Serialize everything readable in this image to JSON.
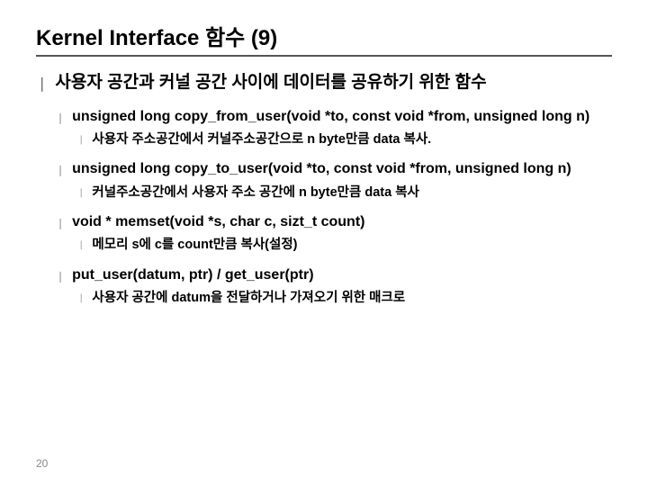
{
  "title": "Kernel Interface 함수 (9)",
  "main": {
    "text": "사용자 공간과 커널 공간 사이에 데이터를 공유하기 위한 함수"
  },
  "items": [
    {
      "heading": "unsigned long copy_from_user(void *to, const void *from, unsigned long n)",
      "desc": "사용자 주소공간에서 커널주소공간으로 n byte만큼 data 복사."
    },
    {
      "heading": "unsigned long copy_to_user(void *to, const void *from, unsigned long n)",
      "desc": "커널주소공간에서 사용자 주소 공간에 n byte만큼 data 복사"
    },
    {
      "heading": "void * memset(void *s, char c, sizt_t count)",
      "desc": "메모리 s에 c를 count만큼 복사(설정)"
    },
    {
      "heading": "put_user(datum, ptr) / get_user(ptr)",
      "desc": "사용자 공간에 datum을 전달하거나 가져오기 위한 매크로"
    }
  ],
  "pageNumber": "20"
}
